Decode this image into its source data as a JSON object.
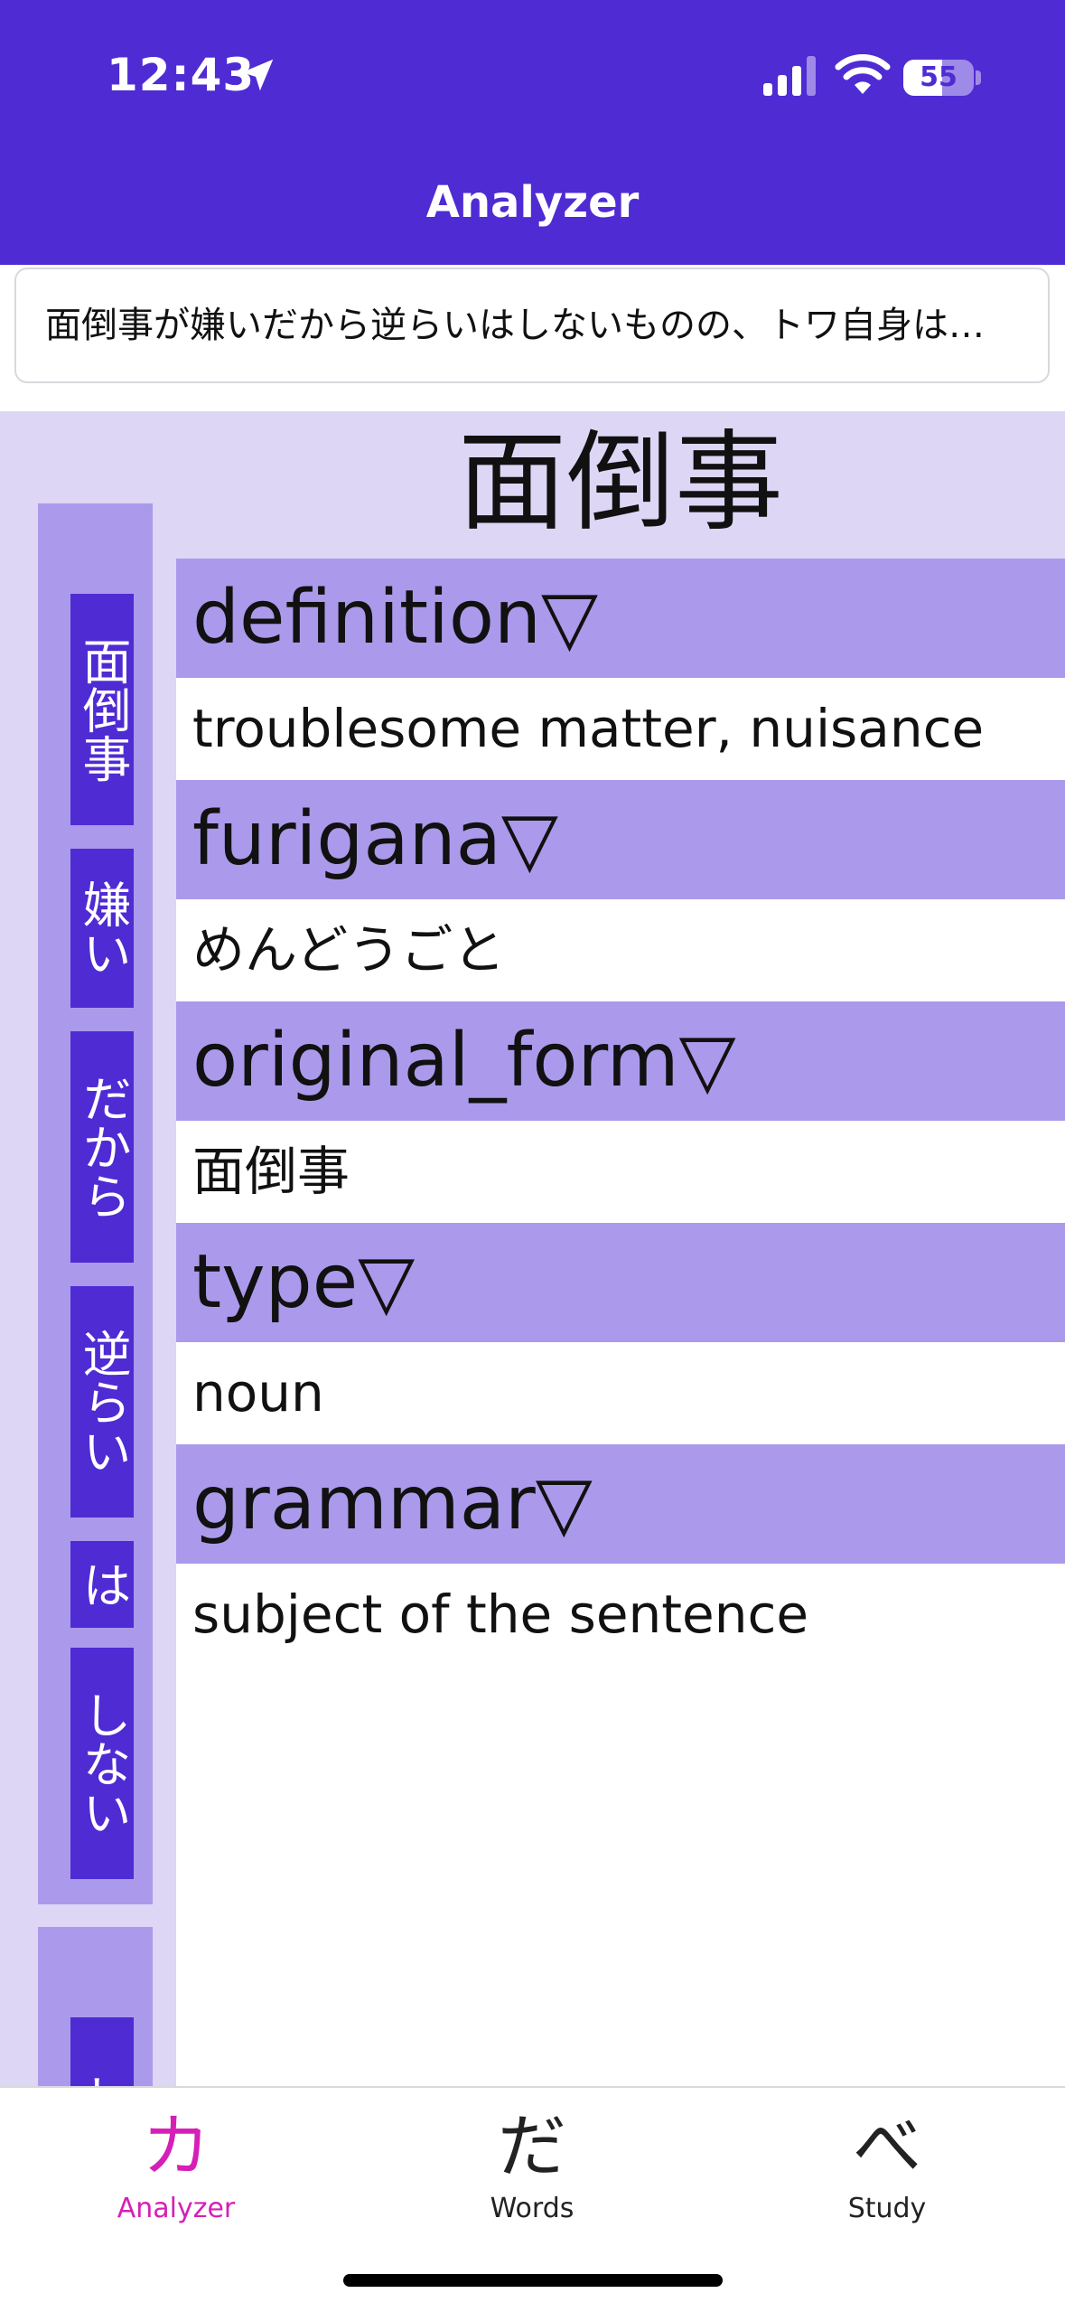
{
  "status_bar": {
    "time": "12:43",
    "battery": "55",
    "battery_level": 0.55
  },
  "header": {
    "title": "Analyzer"
  },
  "sentence": {
    "text": "面倒事が嫌いだから逆らいはしないものの、トワ自身は…"
  },
  "word": {
    "title": "面倒事",
    "properties": [
      {
        "key": "definition▽",
        "value": "troublesome matter, nuisance"
      },
      {
        "key": "furigana▽",
        "value": "めんどうごと"
      },
      {
        "key": "original_form▽",
        "value": "面倒事"
      },
      {
        "key": "type▽",
        "value": "noun"
      },
      {
        "key": "grammar▽",
        "value": "subject of the sentence"
      }
    ]
  },
  "tokens": [
    "面倒事",
    "嫌い",
    "だから",
    "逆らい",
    "は",
    "しない",
    "ト"
  ],
  "tabs": [
    {
      "icon": "カ",
      "label": "Analyzer",
      "active": true
    },
    {
      "icon": "だ",
      "label": "Words",
      "active": false
    },
    {
      "icon": "べ",
      "label": "Study",
      "active": false
    }
  ],
  "colors": {
    "primary": "#4f2bd4",
    "accent_tab": "#d61fb7",
    "light": "#ddd6f5",
    "medium": "#ab9aeb"
  }
}
